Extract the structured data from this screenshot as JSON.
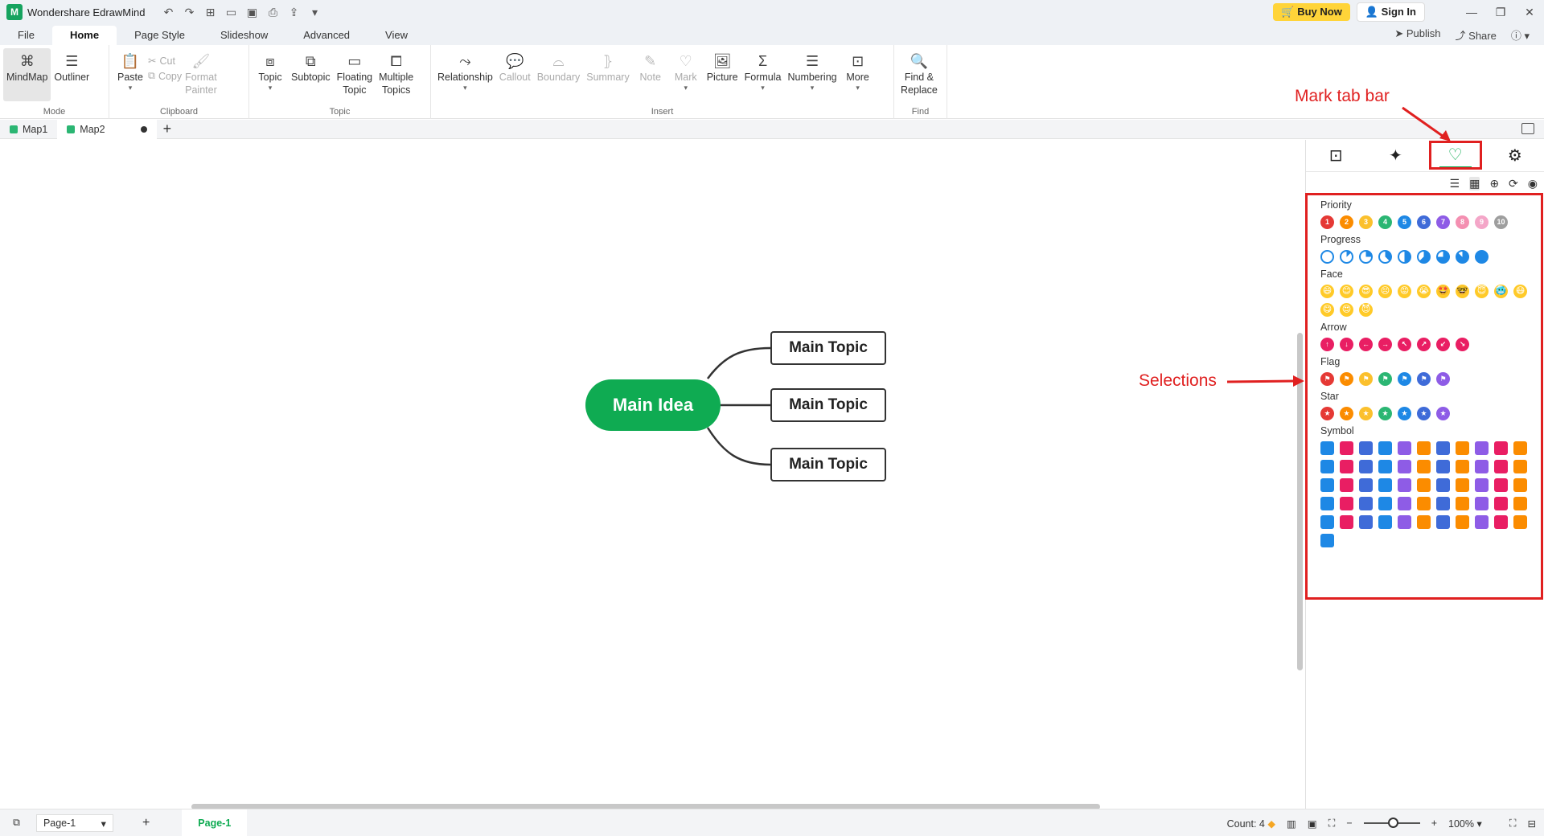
{
  "app": {
    "title": "Wondershare EdrawMind",
    "logo": "M"
  },
  "title_bar": {
    "quick_access_icons": [
      "undo-icon",
      "redo-icon",
      "new-icon",
      "open-icon",
      "save-icon",
      "print-icon",
      "export-icon",
      "customize-icon"
    ],
    "buy_now": "Buy Now",
    "sign_in": "Sign In",
    "window_controls": [
      "minimize-icon",
      "restore-icon",
      "close-icon"
    ]
  },
  "menu": {
    "tabs": [
      "File",
      "Home",
      "Page Style",
      "Slideshow",
      "Advanced",
      "View"
    ],
    "active": "Home",
    "right": {
      "publish": "Publish",
      "share": "Share",
      "help": "?"
    }
  },
  "ribbon": {
    "mode": {
      "label": "Mode",
      "mindmap": "MindMap",
      "outliner": "Outliner"
    },
    "clipboard": {
      "label": "Clipboard",
      "paste": "Paste",
      "cut": "Cut",
      "copy": "Copy",
      "format_painter_1": "Format",
      "format_painter_2": "Painter"
    },
    "topic": {
      "label": "Topic",
      "topic": "Topic",
      "subtopic": "Subtopic",
      "floating_1": "Floating",
      "floating_2": "Topic",
      "multiple_1": "Multiple",
      "multiple_2": "Topics"
    },
    "insert": {
      "label": "Insert",
      "relationship": "Relationship",
      "callout": "Callout",
      "boundary": "Boundary",
      "summary": "Summary",
      "note": "Note",
      "mark": "Mark",
      "picture": "Picture",
      "formula": "Formula",
      "numbering": "Numbering",
      "more": "More"
    },
    "find": {
      "label": "Find",
      "find_replace_1": "Find &",
      "find_replace_2": "Replace"
    }
  },
  "doc_tabs": [
    {
      "label": "Map1"
    },
    {
      "label": "Map2"
    }
  ],
  "canvas": {
    "root": "Main Idea",
    "topics": [
      "Main Topic",
      "Main Topic",
      "Main Topic"
    ]
  },
  "annotations": {
    "mark_tab_bar": "Mark tab bar",
    "selections": "Selections"
  },
  "side_panel": {
    "tabs": [
      "style-icon",
      "ai-icon",
      "mark-icon",
      "theme-icon"
    ],
    "active_tab": "mark-icon",
    "groups": {
      "priority": {
        "title": "Priority",
        "items": [
          "1",
          "2",
          "3",
          "4",
          "5",
          "6",
          "7",
          "8",
          "9",
          "10"
        ],
        "colors": [
          "#e53935",
          "#fb8c00",
          "#fbc02d",
          "#2bb673",
          "#1e88e5",
          "#3f6bd8",
          "#8e5ce6",
          "#f48fb1",
          "#f4a6c8",
          "#9e9e9e"
        ]
      },
      "progress": {
        "title": "Progress",
        "count": 9
      },
      "face": {
        "title": "Face",
        "items": [
          "😄",
          "😊",
          "😎",
          "😣",
          "😡",
          "😭",
          "🤩",
          "🤓",
          "😇",
          "🥶",
          "😷",
          "😋",
          "😍",
          "😈"
        ]
      },
      "arrow": {
        "title": "Arrow",
        "items": [
          "↑",
          "↓",
          "←",
          "→",
          "↖",
          "↗",
          "↙",
          "↘"
        ]
      },
      "flag": {
        "title": "Flag",
        "colors": [
          "#e53935",
          "#fb8c00",
          "#fbc02d",
          "#2bb673",
          "#1e88e5",
          "#3f6bd8",
          "#8e5ce6"
        ]
      },
      "star": {
        "title": "Star",
        "colors": [
          "#e53935",
          "#fb8c00",
          "#fbc02d",
          "#2bb673",
          "#1e88e5",
          "#3f6bd8",
          "#8e5ce6"
        ]
      },
      "symbol": {
        "title": "Symbol",
        "count": 56
      }
    }
  },
  "status_bar": {
    "page_select": "Page-1",
    "active_page": "Page-1",
    "count": "Count: 4",
    "zoom": "100%"
  }
}
